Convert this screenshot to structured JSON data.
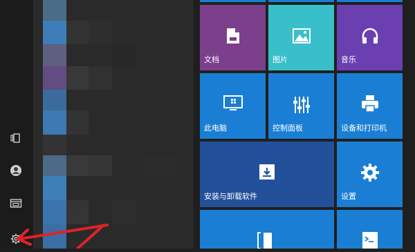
{
  "colors": {
    "rail_bg": "#1b1b1b",
    "tile_purple": "#7b3f8c",
    "tile_teal": "#39bfc9",
    "tile_violet": "#6b3fb0",
    "tile_blue": "#1a7fd4",
    "tile_navy": "#23509a",
    "arrow": "#e0222a"
  },
  "rail": {
    "items": [
      {
        "name": "tablet-mode-icon"
      },
      {
        "name": "user-account-icon"
      },
      {
        "name": "file-explorer-icon"
      },
      {
        "name": "settings-gear-icon"
      }
    ]
  },
  "tiles": [
    {
      "id": "documents",
      "label": "文档",
      "icon": "document-icon"
    },
    {
      "id": "pictures",
      "label": "图片",
      "icon": "picture-icon"
    },
    {
      "id": "music",
      "label": "音乐",
      "icon": "headphones-icon"
    },
    {
      "id": "this-pc",
      "label": "此电脑",
      "icon": "monitor-icon"
    },
    {
      "id": "control-panel",
      "label": "控制面板",
      "icon": "sliders-icon"
    },
    {
      "id": "devices-printers",
      "label": "设备和打印机",
      "icon": "printer-icon"
    },
    {
      "id": "install-uninstall",
      "label": "安装与卸载软件",
      "icon": "archive-box-icon"
    },
    {
      "id": "settings",
      "label": "设置",
      "icon": "gear-icon"
    },
    {
      "id": "bottom-left",
      "label": "",
      "icon": "bracket-icon"
    },
    {
      "id": "bottom-right",
      "label": "",
      "icon": "terminal-icon"
    }
  ],
  "annotation": {
    "type": "red-arrow",
    "points_to": "settings-gear-icon"
  }
}
